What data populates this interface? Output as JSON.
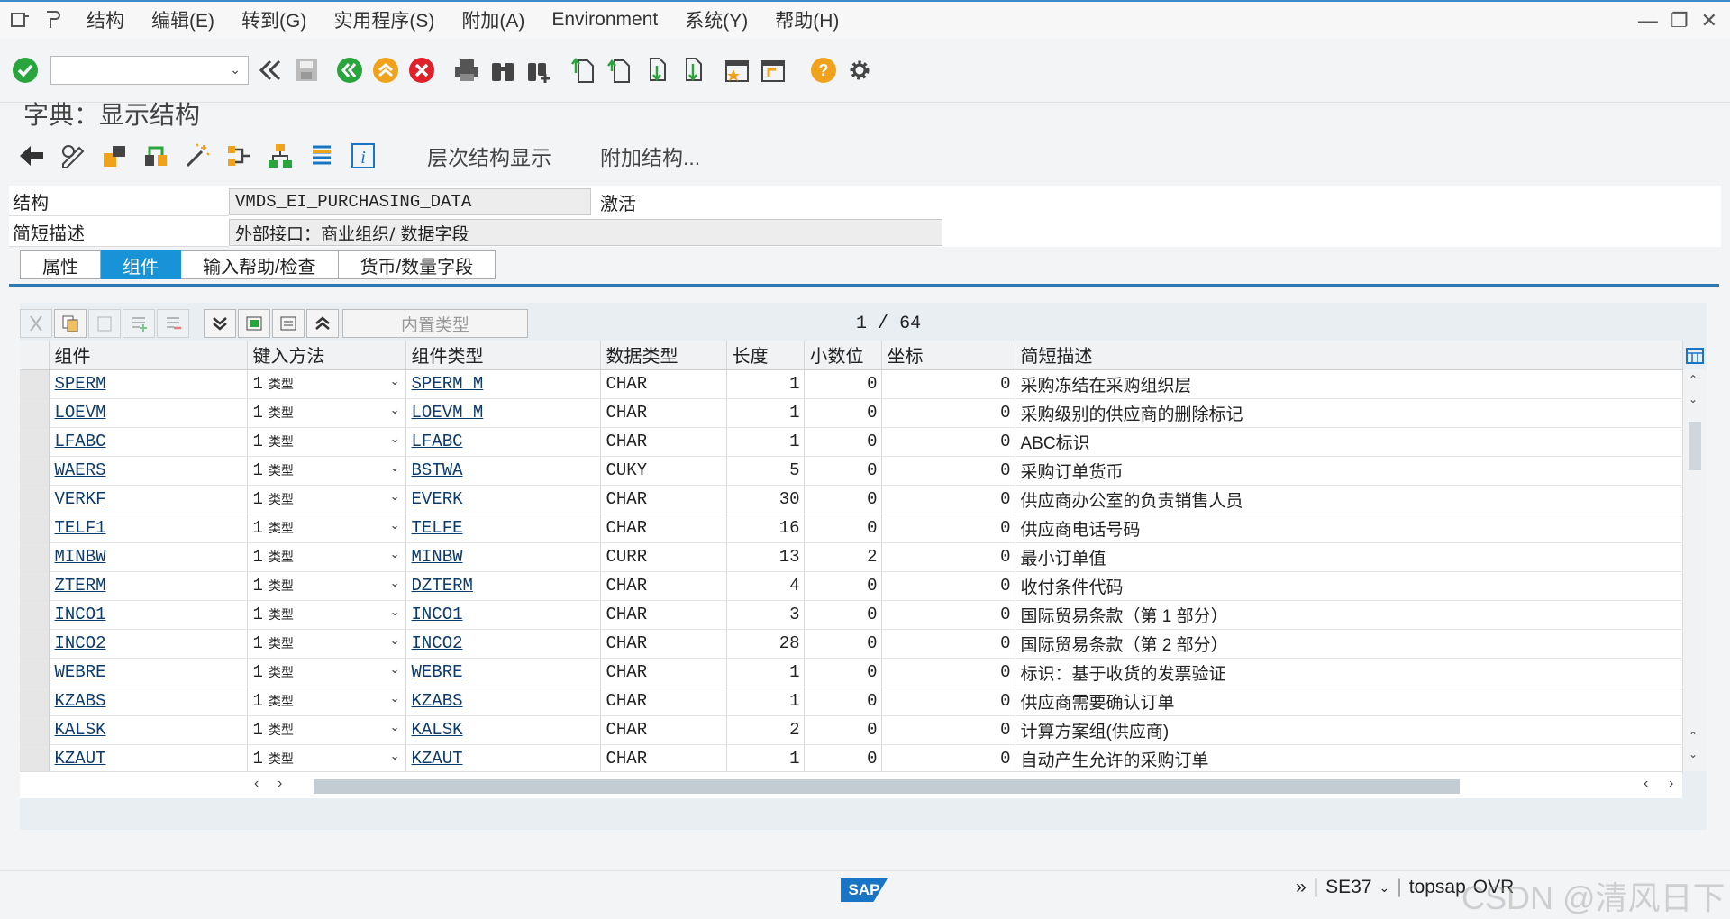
{
  "menu": {
    "items": [
      "结构",
      "编辑(E)",
      "转到(G)",
      "实用程序(S)",
      "附加(A)",
      "Environment",
      "系统(Y)",
      "帮助(H)"
    ]
  },
  "window": {
    "minimize": "—",
    "restore": "❐",
    "close": "✕"
  },
  "title": "字典：显示结构",
  "app_toolbar": {
    "hierarchy_label": "层次结构显示",
    "append_label": "附加结构..."
  },
  "header": {
    "structure_label": "结构",
    "structure_value": "VMDS_EI_PURCHASING_DATA",
    "status": "激活",
    "desc_label": "简短描述",
    "desc_value": "外部接口：商业组织/ 数据字段"
  },
  "tabs": [
    "属性",
    "组件",
    "输入帮助/检查",
    "货币/数量字段"
  ],
  "grid": {
    "filter_placeholder": "内置类型",
    "pager_current": "1",
    "pager_sep": "/",
    "pager_total": "64",
    "columns": [
      "组件",
      "键入方法",
      "组件类型",
      "数据类型",
      "长度",
      "小数位",
      "坐标",
      "简短描述"
    ],
    "rows": [
      {
        "comp": "SPERM",
        "typing": "1",
        "kind": "类型",
        "comptype": "SPERM_M",
        "dtype": "CHAR",
        "len": "1",
        "dec": "0",
        "coord": "0",
        "desc": "采购冻结在采购组织层"
      },
      {
        "comp": "LOEVM",
        "typing": "1",
        "kind": "类型",
        "comptype": "LOEVM_M",
        "dtype": "CHAR",
        "len": "1",
        "dec": "0",
        "coord": "0",
        "desc": "采购级别的供应商的删除标记"
      },
      {
        "comp": "LFABC",
        "typing": "1",
        "kind": "类型",
        "comptype": "LFABC",
        "dtype": "CHAR",
        "len": "1",
        "dec": "0",
        "coord": "0",
        "desc": "ABC标识"
      },
      {
        "comp": "WAERS",
        "typing": "1",
        "kind": "类型",
        "comptype": "BSTWA",
        "dtype": "CUKY",
        "len": "5",
        "dec": "0",
        "coord": "0",
        "desc": "采购订单货币"
      },
      {
        "comp": "VERKF",
        "typing": "1",
        "kind": "类型",
        "comptype": "EVERK",
        "dtype": "CHAR",
        "len": "30",
        "dec": "0",
        "coord": "0",
        "desc": "供应商办公室的负责销售人员"
      },
      {
        "comp": "TELF1",
        "typing": "1",
        "kind": "类型",
        "comptype": "TELFE",
        "dtype": "CHAR",
        "len": "16",
        "dec": "0",
        "coord": "0",
        "desc": "供应商电话号码"
      },
      {
        "comp": "MINBW",
        "typing": "1",
        "kind": "类型",
        "comptype": "MINBW",
        "dtype": "CURR",
        "len": "13",
        "dec": "2",
        "coord": "0",
        "desc": "最小订单值"
      },
      {
        "comp": "ZTERM",
        "typing": "1",
        "kind": "类型",
        "comptype": "DZTERM",
        "dtype": "CHAR",
        "len": "4",
        "dec": "0",
        "coord": "0",
        "desc": "收付条件代码"
      },
      {
        "comp": "INCO1",
        "typing": "1",
        "kind": "类型",
        "comptype": "INCO1",
        "dtype": "CHAR",
        "len": "3",
        "dec": "0",
        "coord": "0",
        "desc": "国际贸易条款（第 1 部分）"
      },
      {
        "comp": "INCO2",
        "typing": "1",
        "kind": "类型",
        "comptype": "INCO2",
        "dtype": "CHAR",
        "len": "28",
        "dec": "0",
        "coord": "0",
        "desc": "国际贸易条款（第 2 部分）"
      },
      {
        "comp": "WEBRE",
        "typing": "1",
        "kind": "类型",
        "comptype": "WEBRE",
        "dtype": "CHAR",
        "len": "1",
        "dec": "0",
        "coord": "0",
        "desc": "标识：基于收货的发票验证"
      },
      {
        "comp": "KZABS",
        "typing": "1",
        "kind": "类型",
        "comptype": "KZABS",
        "dtype": "CHAR",
        "len": "1",
        "dec": "0",
        "coord": "0",
        "desc": "供应商需要确认订单"
      },
      {
        "comp": "KALSK",
        "typing": "1",
        "kind": "类型",
        "comptype": "KALSK",
        "dtype": "CHAR",
        "len": "2",
        "dec": "0",
        "coord": "0",
        "desc": "计算方案组(供应商)"
      },
      {
        "comp": "KZAUT",
        "typing": "1",
        "kind": "类型",
        "comptype": "KZAUT",
        "dtype": "CHAR",
        "len": "1",
        "dec": "0",
        "coord": "0",
        "desc": "自动产生允许的采购订单"
      }
    ]
  },
  "status": {
    "tcode": "SE37",
    "system": "topsap",
    "mode": "OVR",
    "sap_logo": "SAP"
  },
  "watermark": "CSDN @清风日下"
}
